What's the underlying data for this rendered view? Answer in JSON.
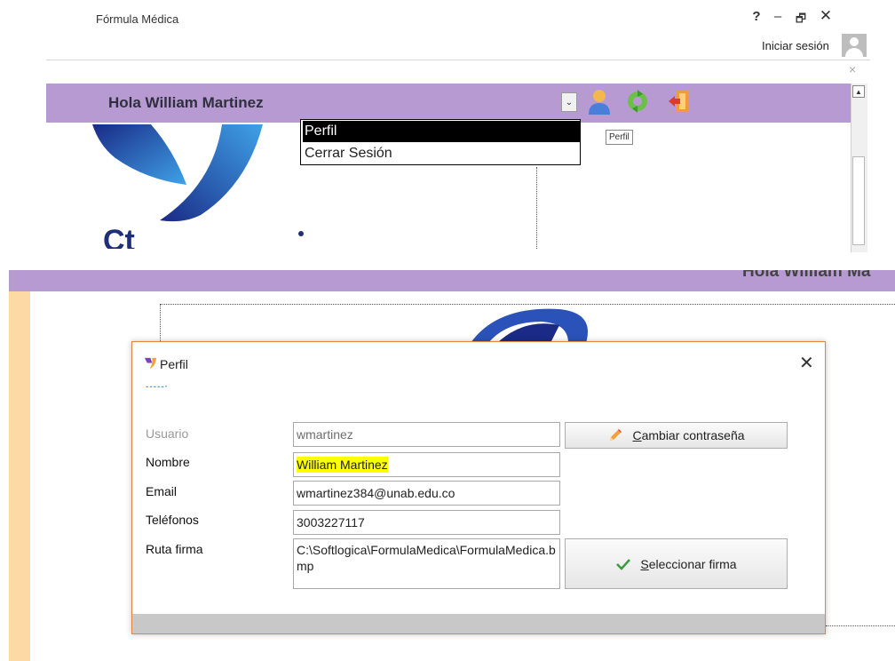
{
  "top_window": {
    "title": "Fórmula Médica",
    "controls": {
      "help": "?",
      "minimize": "–",
      "restore": "🗗",
      "close": "✕"
    },
    "signin_label": "Iniciar sesión",
    "notification_close": "×"
  },
  "header": {
    "greeting": "Hola William Martinez",
    "dropdown_arrow": "⌄",
    "icons": [
      "user-icon",
      "refresh-icon",
      "exit-icon"
    ]
  },
  "dropdown_menu": {
    "items": [
      {
        "label": "Perfil",
        "selected": true
      },
      {
        "label": "Cerrar Sesión",
        "selected": false
      }
    ]
  },
  "tooltip": {
    "text": "Perfil"
  },
  "logo_text_top": "Ct",
  "bottom": {
    "greeting": "Hola William Ma"
  },
  "dialog": {
    "title": "Perfil",
    "close": "✕",
    "accent": "-----·",
    "labels": {
      "usuario": "Usuario",
      "nombre": "Nombre",
      "email": "Email",
      "telefonos": "Teléfonos",
      "ruta_firma": "Ruta firma"
    },
    "values": {
      "usuario": "wmartinez",
      "nombre": "William Martinez",
      "email": "wmartinez384@unab.edu.co",
      "telefonos": "3003227117",
      "ruta_firma": "C:\\Softlogica\\FormulaMedica\\FormulaMedica.bmp"
    },
    "buttons": {
      "cambiar_contrasena": {
        "mnemonic": "C",
        "rest": "ambiar contraseña"
      },
      "seleccionar_firma": {
        "mnemonic": "S",
        "rest": "eleccionar firma"
      }
    }
  },
  "colors": {
    "header_bar": "#b89ad3",
    "sidebar": "#fdd9a6",
    "dialog_border": "#e4853e",
    "highlight": "#ffff00"
  }
}
